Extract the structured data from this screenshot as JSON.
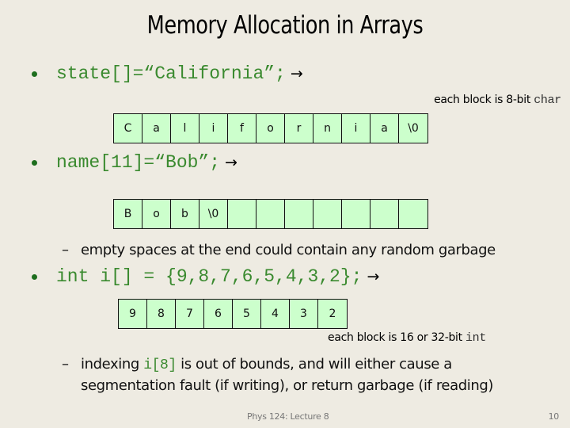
{
  "slide": {
    "title": "Memory Allocation in Arrays",
    "colors": {
      "background": "#eeebe2",
      "code": "#3a8a2f",
      "bullet": "#1e6e1e",
      "cell_fill": "#ccffcc",
      "cell_border": "#111111"
    },
    "bullets": [
      {
        "code": "state[]=“California”;",
        "arrow": "→",
        "note_prefix": "each block is 8-bit ",
        "note_code": "char",
        "cells": [
          "C",
          "a",
          "l",
          "i",
          "f",
          "o",
          "r",
          "n",
          "i",
          "a",
          "\\0"
        ]
      },
      {
        "code": "name[11]=“Bob”;",
        "arrow": "→",
        "cells": [
          "B",
          "o",
          "b",
          "\\0",
          "",
          "",
          "",
          "",
          "",
          "",
          ""
        ],
        "sub": "empty spaces at the end could contain any random garbage"
      },
      {
        "code": "int i[] = {9,8,7,6,5,4,3,2};",
        "arrow": "→",
        "cells": [
          "9",
          "8",
          "7",
          "6",
          "5",
          "4",
          "3",
          "2"
        ],
        "note_prefix": "each block is 16 or 32-bit ",
        "note_code": "int",
        "sub_prefix": "indexing ",
        "sub_code": "i[8]",
        "sub_suffix_line1": " is out of bounds, and will either cause a",
        "sub_line2": "segmentation fault (if writing), or return garbage (if reading)"
      }
    ],
    "footer": {
      "course": "Phys 124: Lecture 8",
      "page": "10"
    }
  }
}
